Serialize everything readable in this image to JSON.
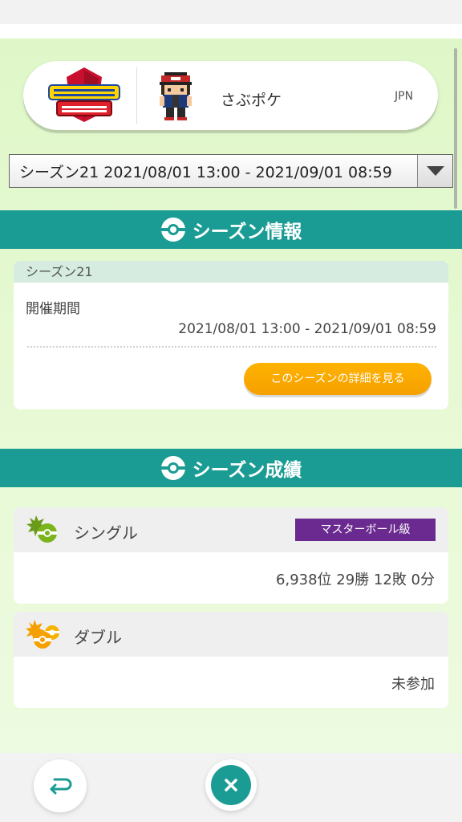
{
  "profile": {
    "game_logo_text": "ポケットモンスター シールド",
    "trainer_name": "さぶポケ",
    "region": "JPN"
  },
  "season_select": {
    "selected": "シーズン21 2021/08/01 13:00 - 2021/09/01 08:59"
  },
  "season_info": {
    "header": "シーズン情報",
    "season_label": "シーズン21",
    "period_label": "開催期間",
    "period_value": "2021/08/01 13:00 - 2021/09/01 08:59",
    "detail_button": "このシーズンの詳細を見る"
  },
  "season_results": {
    "header": "シーズン成績",
    "single": {
      "title": "シングル",
      "rank_badge": "マスターボール級",
      "result": "6,938位 29勝 12敗 0分"
    },
    "double": {
      "title": "ダブル",
      "result": "未参加"
    }
  },
  "colors": {
    "teal": "#1a9c94",
    "orange": "#f5a000",
    "purple": "#6a2a8f"
  },
  "icons": [
    "back-icon",
    "close-icon",
    "monster-ball-icon",
    "single-battle-icon",
    "double-battle-icon"
  ]
}
